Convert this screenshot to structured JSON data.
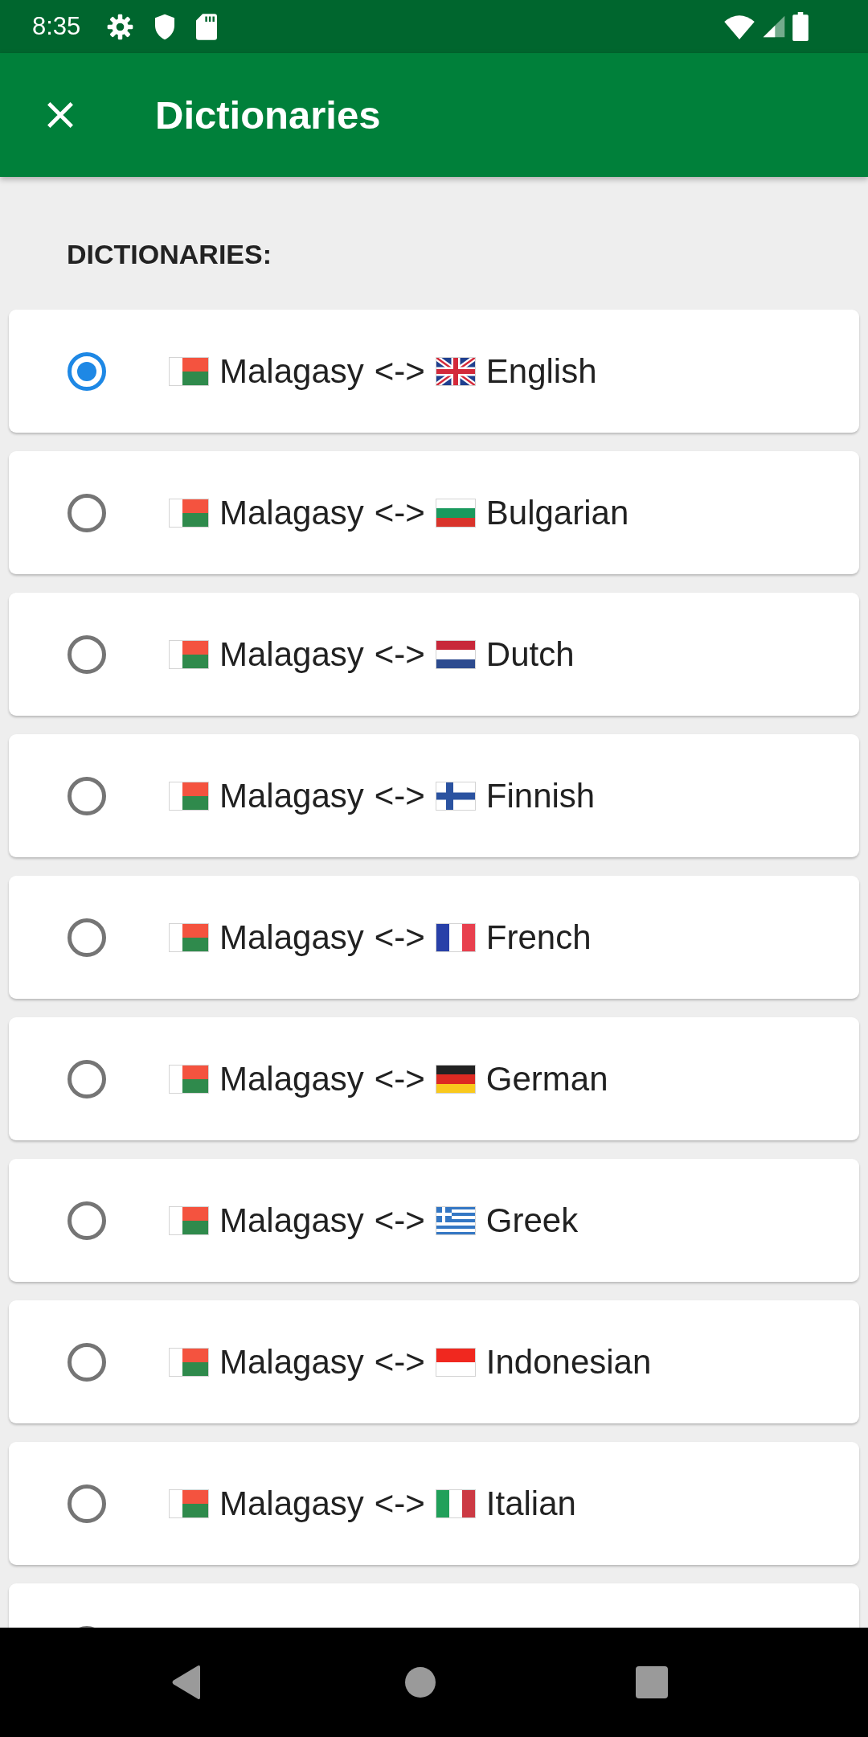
{
  "status_bar": {
    "time": "8:35"
  },
  "app_bar": {
    "title": "Dictionaries"
  },
  "section_label": "DICTIONARIES:",
  "dictionaries": [
    {
      "selected": true,
      "source_flag": {
        "kind": "mg"
      },
      "source": "Malagasy",
      "separator": "<->",
      "target_flag": {
        "kind": "gb"
      },
      "target": "English"
    },
    {
      "selected": false,
      "source_flag": {
        "kind": "mg"
      },
      "source": "Malagasy",
      "separator": "<->",
      "target_flag": {
        "kind": "bg"
      },
      "target": "Bulgarian"
    },
    {
      "selected": false,
      "source_flag": {
        "kind": "mg"
      },
      "source": "Malagasy",
      "separator": "<->",
      "target_flag": {
        "kind": "nl"
      },
      "target": "Dutch"
    },
    {
      "selected": false,
      "source_flag": {
        "kind": "mg"
      },
      "source": "Malagasy",
      "separator": "<->",
      "target_flag": {
        "kind": "fi"
      },
      "target": "Finnish"
    },
    {
      "selected": false,
      "source_flag": {
        "kind": "mg"
      },
      "source": "Malagasy",
      "separator": "<->",
      "target_flag": {
        "kind": "fr"
      },
      "target": "French"
    },
    {
      "selected": false,
      "source_flag": {
        "kind": "mg"
      },
      "source": "Malagasy",
      "separator": "<->",
      "target_flag": {
        "kind": "de"
      },
      "target": "German"
    },
    {
      "selected": false,
      "source_flag": {
        "kind": "mg"
      },
      "source": "Malagasy",
      "separator": "<->",
      "target_flag": {
        "kind": "gr"
      },
      "target": "Greek"
    },
    {
      "selected": false,
      "source_flag": {
        "kind": "mg"
      },
      "source": "Malagasy",
      "separator": "<->",
      "target_flag": {
        "kind": "id"
      },
      "target": "Indonesian"
    },
    {
      "selected": false,
      "source_flag": {
        "kind": "mg"
      },
      "source": "Malagasy",
      "separator": "<->",
      "target_flag": {
        "kind": "it"
      },
      "target": "Italian"
    },
    {
      "selected": false
    }
  ]
}
